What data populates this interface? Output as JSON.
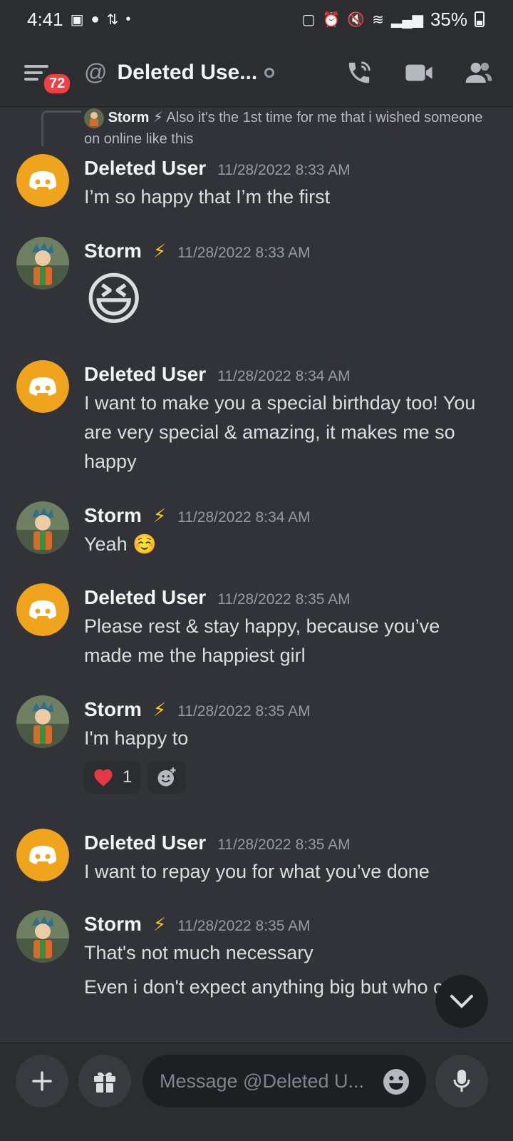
{
  "status_bar": {
    "time": "4:41",
    "battery": "35%"
  },
  "header": {
    "badge_count": "72",
    "title": "Deleted Use...",
    "at_symbol": "@"
  },
  "reply_reference": {
    "author": "Storm",
    "author_emoji": "⚡",
    "text": "Also it's the 1st time for me that i wished someone on online like this"
  },
  "messages": [
    {
      "author": "Deleted User",
      "time": "11/28/2022 8:33 AM",
      "text": "I’m so happy that I’m the first"
    },
    {
      "author": "Storm",
      "emoji": "⚡",
      "time": "11/28/2022 8:33 AM",
      "text": "😆"
    },
    {
      "author": "Deleted User",
      "time": "11/28/2022 8:34 AM",
      "text": "I want to make you a special birthday too! You are very special & amazing, it makes me so happy"
    },
    {
      "author": "Storm",
      "emoji": "⚡",
      "time": "11/28/2022 8:34 AM",
      "text": "Yeah ☺️"
    },
    {
      "author": "Deleted User",
      "time": "11/28/2022 8:35 AM",
      "text": "Please rest & stay happy, because you’ve made me the happiest girl"
    },
    {
      "author": "Storm",
      "emoji": "⚡",
      "time": "11/28/2022 8:35 AM",
      "text": "I'm happy to",
      "reaction_count": "1"
    },
    {
      "author": "Deleted User",
      "time": "11/28/2022 8:35 AM",
      "text": "I want to repay you for what you’ve done"
    },
    {
      "author": "Storm",
      "emoji": "⚡",
      "time": "11/28/2022 8:35 AM",
      "text": "That's not much necessary",
      "text2": "Even i don't expect anything big but who can"
    }
  ],
  "composer": {
    "placeholder": "Message @Deleted U..."
  },
  "colors": {
    "background": "#313338",
    "bar": "#2b2d31",
    "discord_avatar": "#f0a31c",
    "badge": "#f23f43"
  }
}
